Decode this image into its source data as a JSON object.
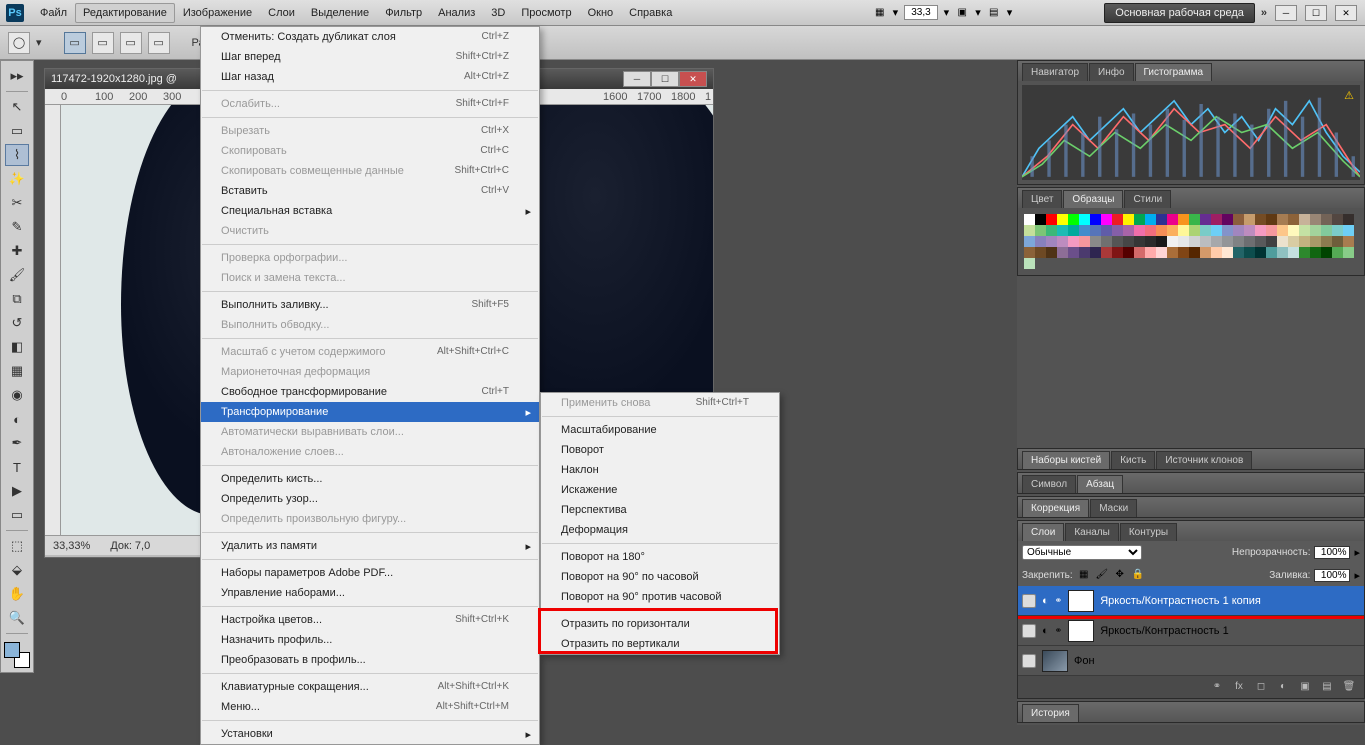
{
  "menubar": {
    "items": [
      "Файл",
      "Редактирование",
      "Изображение",
      "Слои",
      "Выделение",
      "Фильтр",
      "Анализ",
      "3D",
      "Просмотр",
      "Окно",
      "Справка"
    ],
    "active_index": 1,
    "zoom": "33,3",
    "workspace": "Основная рабочая среда"
  },
  "optionsbar": {
    "feather_label": "Растуше"
  },
  "doc": {
    "title": "117472-1920x1280.jpg @",
    "zoom": "33,33%",
    "doc_info": "Док: 7,0",
    "ruler_marks": [
      "0",
      "100",
      "200",
      "300",
      "1600",
      "1700",
      "1800",
      "1"
    ]
  },
  "edit_menu": [
    {
      "t": "item",
      "label": "Отменить: Создать дубликат слоя",
      "shortcut": "Ctrl+Z"
    },
    {
      "t": "item",
      "label": "Шаг вперед",
      "shortcut": "Shift+Ctrl+Z"
    },
    {
      "t": "item",
      "label": "Шаг назад",
      "shortcut": "Alt+Ctrl+Z"
    },
    {
      "t": "sep"
    },
    {
      "t": "item",
      "label": "Ослабить...",
      "shortcut": "Shift+Ctrl+F",
      "disabled": true
    },
    {
      "t": "sep"
    },
    {
      "t": "item",
      "label": "Вырезать",
      "shortcut": "Ctrl+X",
      "disabled": true
    },
    {
      "t": "item",
      "label": "Скопировать",
      "shortcut": "Ctrl+C",
      "disabled": true
    },
    {
      "t": "item",
      "label": "Скопировать совмещенные данные",
      "shortcut": "Shift+Ctrl+C",
      "disabled": true
    },
    {
      "t": "item",
      "label": "Вставить",
      "shortcut": "Ctrl+V"
    },
    {
      "t": "item",
      "label": "Специальная вставка",
      "arrow": true
    },
    {
      "t": "item",
      "label": "Очистить",
      "disabled": true
    },
    {
      "t": "sep"
    },
    {
      "t": "item",
      "label": "Проверка орфографии...",
      "disabled": true
    },
    {
      "t": "item",
      "label": "Поиск и замена текста...",
      "disabled": true
    },
    {
      "t": "sep"
    },
    {
      "t": "item",
      "label": "Выполнить заливку...",
      "shortcut": "Shift+F5"
    },
    {
      "t": "item",
      "label": "Выполнить обводку...",
      "disabled": true
    },
    {
      "t": "sep"
    },
    {
      "t": "item",
      "label": "Масштаб с учетом содержимого",
      "shortcut": "Alt+Shift+Ctrl+C",
      "disabled": true
    },
    {
      "t": "item",
      "label": "Марионеточная деформация",
      "disabled": true
    },
    {
      "t": "item",
      "label": "Свободное трансформирование",
      "shortcut": "Ctrl+T"
    },
    {
      "t": "item",
      "label": "Трансформирование",
      "arrow": true,
      "highlight": true
    },
    {
      "t": "item",
      "label": "Автоматически выравнивать слои...",
      "disabled": true
    },
    {
      "t": "item",
      "label": "Автоналожение слоев...",
      "disabled": true
    },
    {
      "t": "sep"
    },
    {
      "t": "item",
      "label": "Определить кисть..."
    },
    {
      "t": "item",
      "label": "Определить узор..."
    },
    {
      "t": "item",
      "label": "Определить произвольную фигуру...",
      "disabled": true
    },
    {
      "t": "sep"
    },
    {
      "t": "item",
      "label": "Удалить из памяти",
      "arrow": true
    },
    {
      "t": "sep"
    },
    {
      "t": "item",
      "label": "Наборы параметров Adobe PDF..."
    },
    {
      "t": "item",
      "label": "Управление наборами..."
    },
    {
      "t": "sep"
    },
    {
      "t": "item",
      "label": "Настройка цветов...",
      "shortcut": "Shift+Ctrl+K"
    },
    {
      "t": "item",
      "label": "Назначить профиль..."
    },
    {
      "t": "item",
      "label": "Преобразовать в профиль..."
    },
    {
      "t": "sep"
    },
    {
      "t": "item",
      "label": "Клавиатурные сокращения...",
      "shortcut": "Alt+Shift+Ctrl+K"
    },
    {
      "t": "item",
      "label": "Меню...",
      "shortcut": "Alt+Shift+Ctrl+M"
    },
    {
      "t": "sep"
    },
    {
      "t": "item",
      "label": "Установки",
      "arrow": true
    }
  ],
  "transform_menu": [
    {
      "t": "item",
      "label": "Применить снова",
      "shortcut": "Shift+Ctrl+T",
      "disabled": true
    },
    {
      "t": "sep"
    },
    {
      "t": "item",
      "label": "Масштабирование"
    },
    {
      "t": "item",
      "label": "Поворот"
    },
    {
      "t": "item",
      "label": "Наклон"
    },
    {
      "t": "item",
      "label": "Искажение"
    },
    {
      "t": "item",
      "label": "Перспектива"
    },
    {
      "t": "item",
      "label": "Деформация"
    },
    {
      "t": "sep"
    },
    {
      "t": "item",
      "label": "Поворот на 180°"
    },
    {
      "t": "item",
      "label": "Поворот на 90° по часовой"
    },
    {
      "t": "item",
      "label": "Поворот на 90° против часовой"
    },
    {
      "t": "sep"
    },
    {
      "t": "item",
      "label": "Отразить по горизонтали"
    },
    {
      "t": "item",
      "label": "Отразить по вертикали"
    }
  ],
  "panels": {
    "nav_tabs": [
      "Навигатор",
      "Инфо",
      "Гистограмма"
    ],
    "nav_active": 2,
    "color_tabs": [
      "Цвет",
      "Образцы",
      "Стили"
    ],
    "color_active": 1,
    "brush_tabs": [
      "Наборы кистей",
      "Кисть",
      "Источник клонов"
    ],
    "para_tabs": [
      "Символ",
      "Абзац"
    ],
    "para_active": 1,
    "adjust_tabs": [
      "Коррекция",
      "Маски"
    ],
    "layer_tabs": [
      "Слои",
      "Каналы",
      "Контуры"
    ],
    "layer_active": 0,
    "history_tab": "История"
  },
  "layers": {
    "blend_mode": "Обычные",
    "opacity_label": "Непрозрачность:",
    "opacity": "100%",
    "lock_label": "Закрепить:",
    "fill_label": "Заливка:",
    "fill": "100%",
    "rows": [
      {
        "name": "Яркость/Контрастность 1 копия",
        "selected": true,
        "adj": true
      },
      {
        "name": "Яркость/Контрастность 1",
        "adj": true
      },
      {
        "name": "Фон",
        "bg": true
      }
    ]
  },
  "swatch_colors": [
    "#ffffff",
    "#000000",
    "#ff0000",
    "#ffff00",
    "#00ff00",
    "#00ffff",
    "#0000ff",
    "#ff00ff",
    "#ed1c24",
    "#fff200",
    "#00a651",
    "#00aeef",
    "#2e3192",
    "#ec008c",
    "#f7941d",
    "#39b54a",
    "#662d91",
    "#9e1f63",
    "#630460",
    "#8b5e3c",
    "#c69c6d",
    "#754c24",
    "#603913",
    "#a67c52",
    "#8c6239",
    "#c7b299",
    "#998675",
    "#736357",
    "#534741",
    "#362f2d",
    "#c4df9b",
    "#7cc576",
    "#3cb878",
    "#1cbbb4",
    "#00a99d",
    "#448ccb",
    "#5674b9",
    "#605ca8",
    "#855fa8",
    "#a864a8",
    "#f06eaa",
    "#f26d7d",
    "#f68e56",
    "#fbaf5d",
    "#fff799",
    "#acd373",
    "#7accc8",
    "#6dcff6",
    "#8393ca",
    "#a186be",
    "#bd8cbf",
    "#f49ac1",
    "#f5989d",
    "#fdc689",
    "#fff9bd",
    "#c4e1a4",
    "#a3d39c",
    "#82ca9c",
    "#7bcdc9",
    "#6ecff6",
    "#7da7d9",
    "#8781bd",
    "#a186be",
    "#bd8cbf",
    "#f49ac1",
    "#f5989d",
    "#898989",
    "#707070",
    "#555555",
    "#464646",
    "#363636",
    "#2b2b2b",
    "#1a1a1a",
    "#f1f1f2",
    "#e6e7e8",
    "#d0d2d3",
    "#bbbdc0",
    "#a6a8ab",
    "#939598",
    "#808284",
    "#6d6e71",
    "#58595b",
    "#404041",
    "#ebe1cd",
    "#d8cca3",
    "#c2b280",
    "#a89968",
    "#8c7b4f",
    "#6e5e3a",
    "#a87c4f",
    "#8b6239",
    "#6d4924",
    "#4f3316",
    "#8d6e97",
    "#6b4f8a",
    "#4b3a6e",
    "#2e2550",
    "#aa3939",
    "#801515",
    "#550000",
    "#d46a6a",
    "#ffaaaa",
    "#ffd4d4",
    "#aa6e39",
    "#804515",
    "#552600",
    "#d49a6a",
    "#ffcbaa",
    "#ffe7d4",
    "#236467",
    "#0d4d4d",
    "#003333",
    "#4f9d9d",
    "#8fc1c1",
    "#c5e0e0",
    "#2d882d",
    "#116611",
    "#004400",
    "#55aa55",
    "#88cc88",
    "#bbe2bb"
  ]
}
